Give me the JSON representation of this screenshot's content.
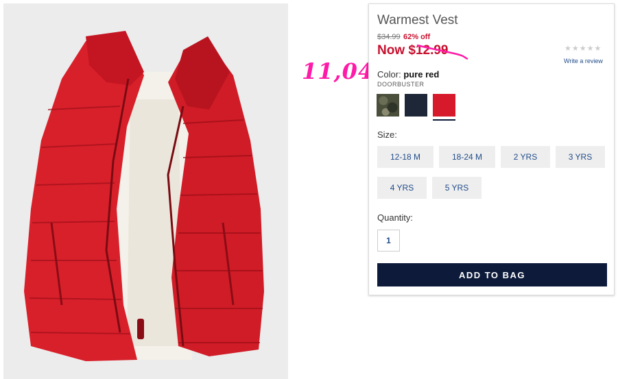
{
  "annotation": {
    "text": "11,04",
    "color": "#ff1aa8"
  },
  "product": {
    "title": "Warmest Vest",
    "original_price": "$34.99",
    "discount": "62% off",
    "now_price": "Now $12.99",
    "write_review": "Write a review",
    "rating_stars": "★★★★★",
    "color_label": "Color:",
    "color_value": "pure red",
    "badge": "DOORBUSTER",
    "swatches": [
      {
        "name": "camo",
        "color": "#4a4f3c"
      },
      {
        "name": "navy",
        "color": "#1d2738"
      },
      {
        "name": "pure red",
        "color": "#d61a2c",
        "selected": true
      }
    ],
    "size_label": "Size:",
    "sizes": [
      "12-18 M",
      "18-24 M",
      "2 YRS",
      "3 YRS",
      "4 YRS",
      "5 YRS"
    ],
    "quantity_label": "Quantity:",
    "quantity": "1",
    "add_to_bag": "ADD TO BAG"
  },
  "colors": {
    "sale_red": "#c8102e",
    "navy": "#0d1a3a",
    "link_blue": "#1f4b8a"
  }
}
